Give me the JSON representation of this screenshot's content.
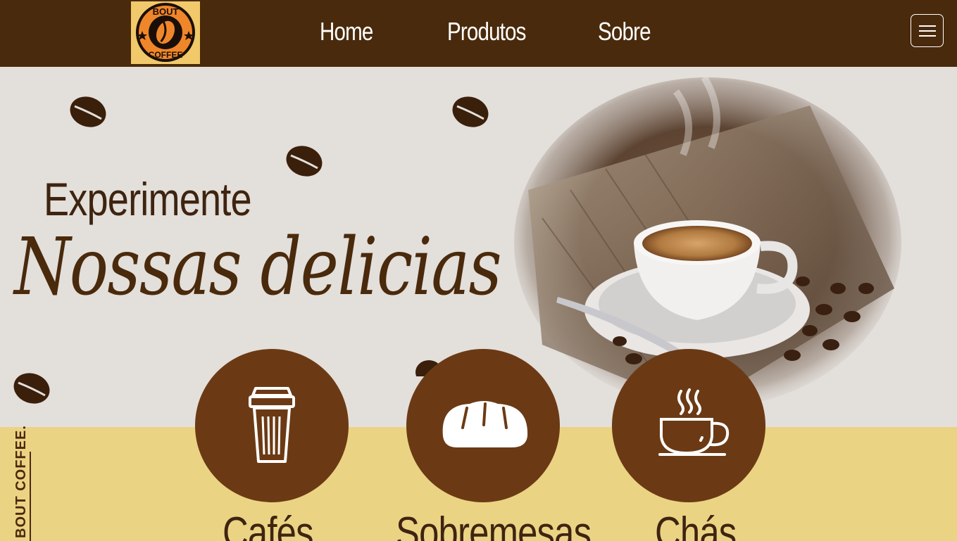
{
  "header": {
    "logo_text": "BOUT COFFEE",
    "nav": [
      {
        "label": "Home"
      },
      {
        "label": "Produtos"
      },
      {
        "label": "Sobre"
      }
    ],
    "menu_icon": "hamburger-icon"
  },
  "hero": {
    "eyebrow": "Experimente",
    "title": "Nossas delicias",
    "image": "coffee-cup-photo"
  },
  "categories": [
    {
      "label": "Cafés",
      "icon": "takeaway-cup-icon"
    },
    {
      "label": "Sobremesas",
      "icon": "bread-icon"
    },
    {
      "label": "Chás",
      "icon": "hot-cup-icon"
    }
  ],
  "side_label": "BOUT COFFEE.",
  "colors": {
    "header_bg": "#4a2a0c",
    "hero_bg": "#e3dfdb",
    "band_bg": "#ebd384",
    "circle": "#6b3a14",
    "text_dark": "#3e2410",
    "logo_bg": "#f2c96a",
    "logo_orange": "#f0862a"
  }
}
